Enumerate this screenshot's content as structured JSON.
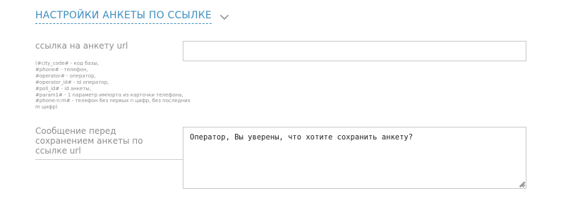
{
  "section": {
    "title": "НАСТРОЙКИ АНКЕТЫ ПО ССЫЛКЕ",
    "toggle_icon": "chevron-down-icon"
  },
  "url_field": {
    "label": "ссылка на анкету url",
    "value": "",
    "placeholder": "",
    "hints": [
      "(#city_code# - код базы,",
      "#phone# - телефон,",
      "#operator# - оператор,",
      "#operator_id# - id оператор,",
      "#poll_id# - id анкеты,",
      "#param1# - 1 параметр импорта из карточки телефона,",
      "#phone:n:m# - телефон без первых n цифр, без последних",
      "m цифр)"
    ]
  },
  "message_field": {
    "label": "Сообщение перед сохранением анкеты по ссылке url",
    "value": "Оператор, Вы уверены, что хотите сохранить анкету?"
  },
  "colors": {
    "accent": "#3f8fbf",
    "label": "#8f8f8f",
    "border": "#c8c8c8"
  }
}
